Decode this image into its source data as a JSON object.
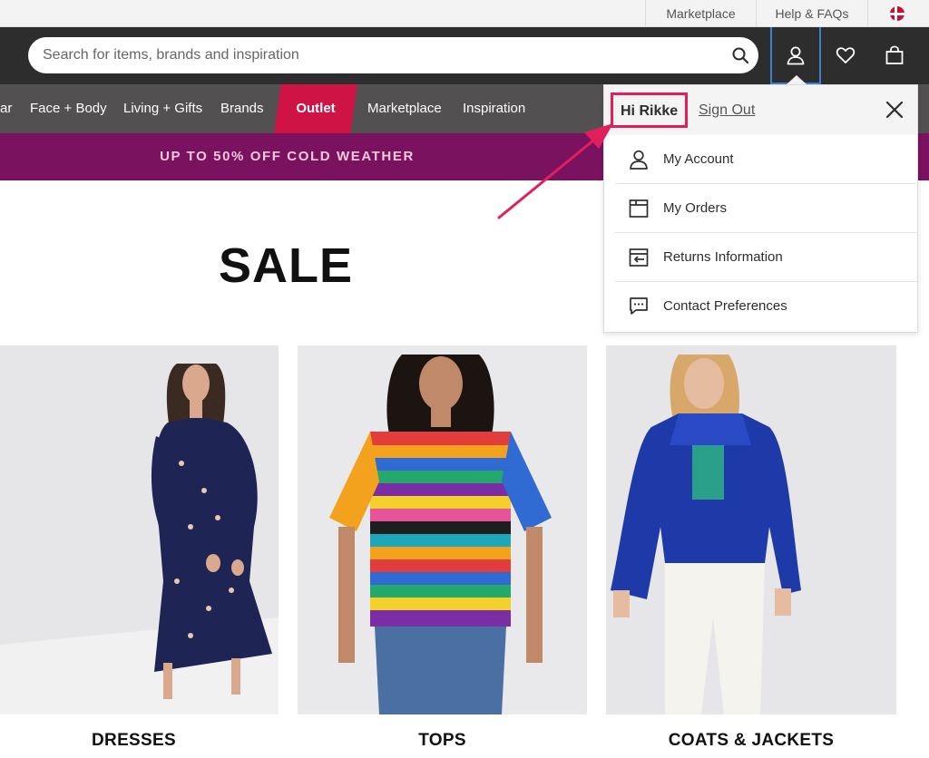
{
  "utility_bar": {
    "marketplace": "Marketplace",
    "help": "Help & FAQs",
    "country_flag": "denmark-flag"
  },
  "header": {
    "search_placeholder": "Search for items, brands and inspiration",
    "icons": [
      "search-icon",
      "user-icon",
      "heart-icon",
      "bag-icon"
    ]
  },
  "nav": {
    "items": [
      "ar",
      "Face + Body",
      "Living + Gifts",
      "Brands",
      "Outlet",
      "Marketplace",
      "Inspiration"
    ]
  },
  "promo": {
    "text": "UP TO 50% OFF COLD WEATHER"
  },
  "main": {
    "title": "SALE"
  },
  "categories": [
    {
      "label": "DRESSES"
    },
    {
      "label": "TOPS"
    },
    {
      "label": "COATS & JACKETS"
    }
  ],
  "account_menu": {
    "greeting": "Hi Rikke",
    "sign_out": "Sign Out",
    "items": [
      {
        "label": "My Account",
        "icon": "user-icon"
      },
      {
        "label": "My Orders",
        "icon": "package-icon"
      },
      {
        "label": "Returns Information",
        "icon": "returns-icon"
      },
      {
        "label": "Contact Preferences",
        "icon": "chat-icon"
      }
    ]
  },
  "colors": {
    "header_bg": "#2d2d2d",
    "nav_bg": "#525050",
    "outlet_accent": "#d01345",
    "promo_bg": "#7a1260",
    "promo_text": "#f7c9d9",
    "highlight": "#e0205a",
    "focus_outline": "#3f7fd0"
  }
}
